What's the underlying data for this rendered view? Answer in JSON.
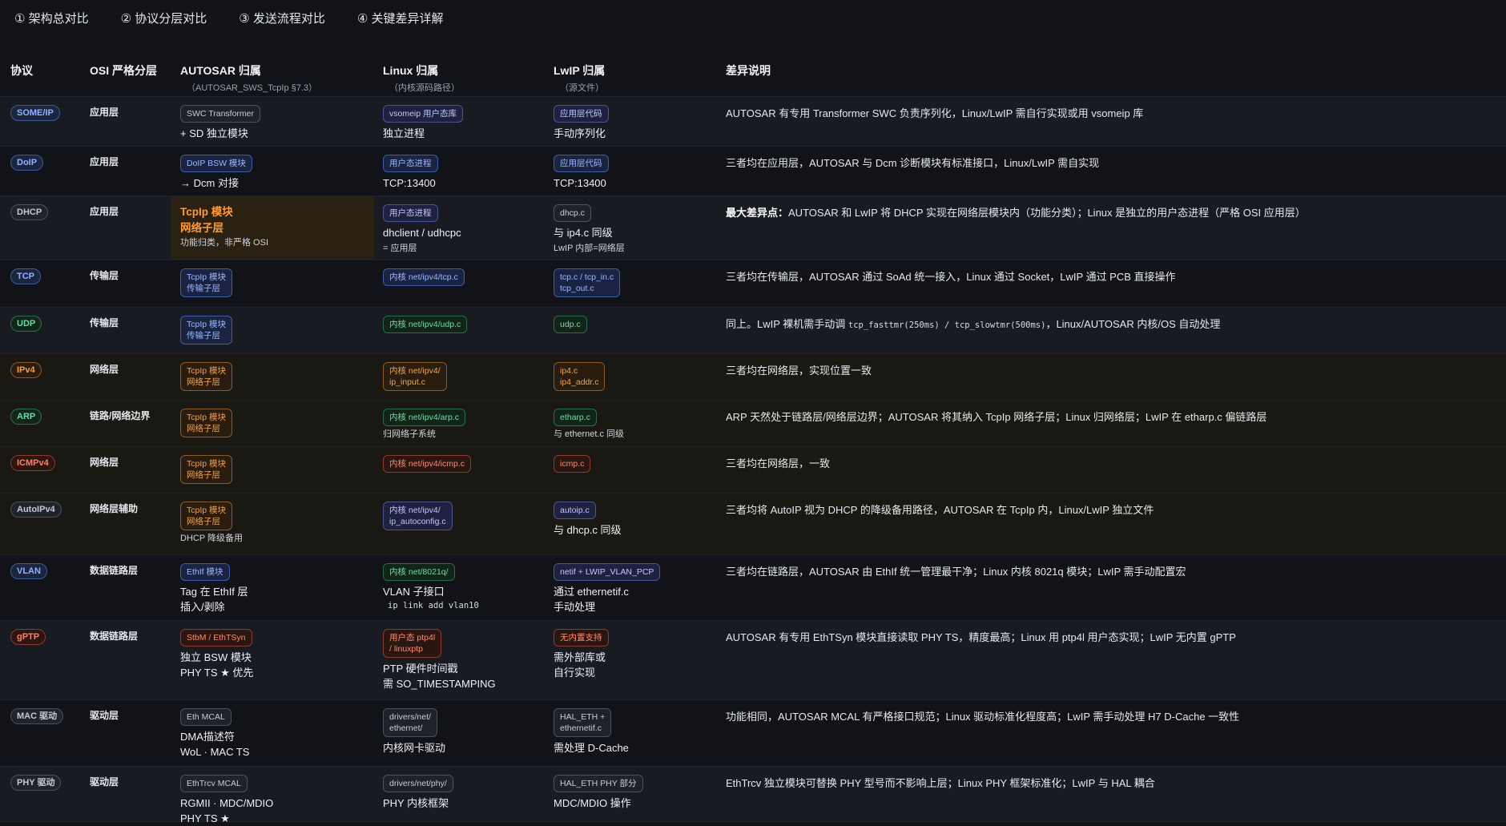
{
  "tabs": [
    "① 架构总对比",
    "② 协议分层对比",
    "③ 发送流程对比",
    "④ 关键差异详解"
  ],
  "header": {
    "proto": "协议",
    "osi": "OSI 严格分层",
    "autosar": "AUTOSAR 归属",
    "autosar_sub": "（AUTOSAR_SWS_TcpIp §7.3）",
    "linux": "Linux 归属",
    "linux_sub": "（内核源码路径）",
    "lwip": "LwIP 归属",
    "lwip_sub": "（源文件）",
    "diff": "差异说明"
  },
  "rows": [
    {
      "proto": "SOME/IP",
      "osi": "应用层",
      "aut_chip": "SWC Transformer",
      "aut_note": "+ SD 独立模块",
      "lin_chip": "vsomeip 用户态库",
      "lin_note": "独立进程",
      "lwip_chip": "应用层代码",
      "lwip_note": "手动序列化",
      "diff": "AUTOSAR 有专用 Transformer SWC 负责序列化，Linux/LwIP 需自行实现或用 vsomeip 库"
    },
    {
      "proto": "DoIP",
      "osi": "应用层",
      "aut_chip": "DoIP BSW 模块",
      "aut_note": "→ Dcm 对接",
      "lin_chip": "用户态进程",
      "lin_note": "TCP:13400",
      "lwip_chip": "应用层代码",
      "lwip_note": "TCP:13400",
      "diff": "三者均在应用层，AUTOSAR 与 Dcm 诊断模块有标准接口，Linux/LwIP 需自实现"
    },
    {
      "proto": "DHCP",
      "osi": "应用层",
      "aut_title1": "TcpIp 模块",
      "aut_title2": "网络子层",
      "aut_note": "功能归类，非严格 OSI",
      "lin_chip": "用户态进程",
      "lin_note": "dhclient / udhcpc",
      "lin_small": "= 应用层",
      "lwip_chip": "dhcp.c",
      "lwip_note": "与 ip4.c 同级",
      "lwip_small": "LwIP 内部=网络层",
      "diff_key": "最大差异点：",
      "diff": "AUTOSAR 和 LwIP 将 DHCP 实现在网络层模块内（功能分类）；Linux 是独立的用户态进程（严格 OSI 应用层）"
    },
    {
      "proto": "TCP",
      "osi": "传输层",
      "aut_chip": "TcpIp 模块\n传输子层",
      "lin_chip": "内核 net/ipv4/tcp.c",
      "lwip_chip": "tcp.c / tcp_in.c\ntcp_out.c",
      "diff": "三者均在传输层，AUTOSAR 通过 SoAd 统一接入，Linux 通过 Socket，LwIP 通过 PCB 直接操作"
    },
    {
      "proto": "UDP",
      "osi": "传输层",
      "aut_chip": "TcpIp 模块\n传输子层",
      "lin_chip": "内核 net/ipv4/udp.c",
      "lwip_chip": "udp.c",
      "diff_pre": "同上。LwIP 裸机需手动调 ",
      "diff_mono": "tcp_fasttmr(250ms) / tcp_slowtmr(500ms)",
      "diff": "，Linux/AUTOSAR 内核/OS 自动处理"
    },
    {
      "proto": "IPv4",
      "osi": "网络层",
      "aut_chip": "TcpIp 模块\n网络子层",
      "lin_chip": "内核 net/ipv4/\nip_input.c",
      "lwip_chip": "ip4.c\nip4_addr.c",
      "diff": "三者均在网络层，实现位置一致"
    },
    {
      "proto": "ARP",
      "osi": "链路/网络边界",
      "aut_chip": "TcpIp 模块\n网络子层",
      "lin_chip": "内核 net/ipv4/arp.c",
      "lin_small": "归网络子系统",
      "lwip_chip": "etharp.c",
      "lwip_small": "与 ethernet.c 同级",
      "diff": "ARP 天然处于链路层/网络层边界；AUTOSAR 将其纳入 TcpIp 网络子层；Linux 归网络层；LwIP 在 etharp.c 偏链路层"
    },
    {
      "proto": "ICMPv4",
      "osi": "网络层",
      "aut_chip": "TcpIp 模块\n网络子层",
      "lin_chip": "内核 net/ipv4/icmp.c",
      "lwip_chip": "icmp.c",
      "diff": "三者均在网络层，一致"
    },
    {
      "proto": "AutoIPv4",
      "osi": "网络层辅助",
      "aut_chip": "TcpIp 模块\n网络子层",
      "aut_small": "DHCP 降级备用",
      "lin_chip": "内核 net/ipv4/\nip_autoconfig.c",
      "lwip_chip": "autoip.c",
      "lwip_note": "与 dhcp.c 同级",
      "diff": "三者均将 AutoIP 视为 DHCP 的降级备用路径，AUTOSAR 在 TcpIp 内，Linux/LwIP 独立文件"
    },
    {
      "proto": "VLAN",
      "osi": "数据链路层",
      "aut_chip": "EthIf 模块",
      "aut_note": "Tag 在 EthIf 层\n插入/剥除",
      "lin_chip": "内核 net/8021q/",
      "lin_note": "VLAN 子接口",
      "lin_mono": "ip link add vlan10",
      "lwip_chip": "netif + LWIP_VLAN_PCP",
      "lwip_note": "通过 ethernetif.c\n手动处理",
      "diff": "三者均在链路层，AUTOSAR 由 EthIf 统一管理最干净；Linux 内核 8021q 模块；LwIP 需手动配置宏"
    },
    {
      "proto": "gPTP",
      "osi": "数据链路层",
      "aut_chip": "StbM / EthTSyn",
      "aut_note": "独立 BSW 模块\nPHY TS ★ 优先",
      "lin_chip": "用户态 ptp4l\n/ linuxptp",
      "lin_note": "PTP 硬件时间戳\n需 SO_TIMESTAMPING",
      "lwip_chip": "无内置支持",
      "lwip_note": "需外部库或\n自行实现",
      "diff": "AUTOSAR 有专用 EthTSyn 模块直接读取 PHY TS，精度最高；Linux 用 ptp4l 用户态实现；LwIP 无内置 gPTP"
    },
    {
      "proto": "MAC 驱动",
      "osi": "驱动层",
      "aut_chip": "Eth MCAL",
      "aut_note": "DMA描述符\nWoL · MAC TS",
      "lin_chip": "drivers/net/\nethernet/",
      "lin_note": "内核网卡驱动",
      "lwip_chip": "HAL_ETH +\nethernetif.c",
      "lwip_note": "需处理 D-Cache",
      "diff": "功能相同，AUTOSAR MCAL 有严格接口规范；Linux 驱动标准化程度高；LwIP 需手动处理 H7 D-Cache 一致性"
    },
    {
      "proto": "PHY 驱动",
      "osi": "驱动层",
      "aut_chip": "EthTrcv MCAL",
      "aut_note": "RGMII · MDC/MDIO\nPHY TS ★",
      "lin_chip": "drivers/net/phy/",
      "lin_note": "PHY 内核框架",
      "lwip_chip": "HAL_ETH PHY 部分",
      "lwip_note": "MDC/MDIO 操作",
      "diff": "EthTrcv 独立模块可替换 PHY 型号而不影响上层；Linux PHY 框架标准化；LwIP 与 HAL 耦合"
    }
  ]
}
